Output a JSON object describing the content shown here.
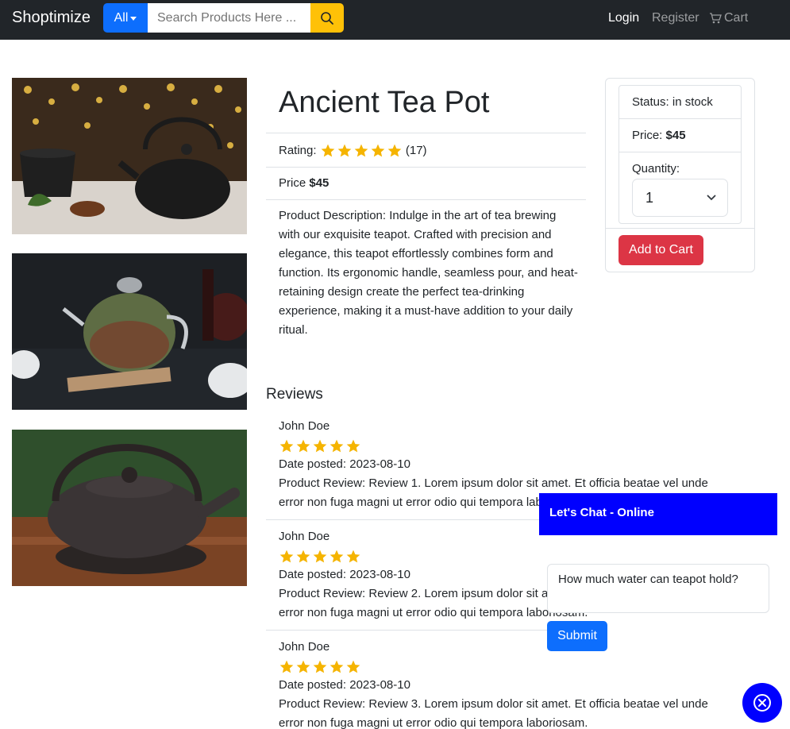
{
  "navbar": {
    "brand": "Shoptimize",
    "category_label": "All",
    "search_placeholder": "Search Products Here ...",
    "login": "Login",
    "register": "Register",
    "cart": "Cart"
  },
  "product": {
    "title": "Ancient Tea Pot",
    "rating_label": "Rating:",
    "rating_stars": 5,
    "rating_count": "(17)",
    "price_label": "Price",
    "price_value": "$45",
    "description": "Product Description: Indulge in the art of tea brewing with our exquisite teapot. Crafted with precision and elegance, this teapot effortlessly combines form and function. Its ergonomic handle, seamless pour, and heat-retaining design create the perfect tea-drinking experience, making it a must-have addition to your daily ritual."
  },
  "cart_card": {
    "status": "Status: in stock",
    "price_label": "Price:",
    "price_value": "$45",
    "quantity_label": "Quantity:",
    "quantity_value": "1",
    "add_button": "Add to Cart"
  },
  "reviews": {
    "heading": "Reviews",
    "items": [
      {
        "name": "John Doe",
        "stars": 5,
        "date": "Date posted: 2023-08-10",
        "line1": "Product Review: Review 1. Lorem ipsum dolor sit amet. Et officia beatae vel unde",
        "line2": "error non fuga magni ut error odio qui tempora laboriosam."
      },
      {
        "name": "John Doe",
        "stars": 5,
        "date": "Date posted: 2023-08-10",
        "line1": "Product Review: Review 2. Lorem ipsum dolor sit amet. Et officia beatae vel unde",
        "line2": "error non fuga magni ut error odio qui tempora laboriosam."
      },
      {
        "name": "John Doe",
        "stars": 5,
        "date": "Date posted: 2023-08-10",
        "line1": "Product Review: Review 3. Lorem ipsum dolor sit amet. Et officia beatae vel unde",
        "line2": "error non fuga magni ut error odio qui tempora laboriosam."
      }
    ]
  },
  "chat": {
    "header": "Let's Chat - Online",
    "input_value": "How much water can teapot hold?",
    "submit": "Submit"
  },
  "colors": {
    "navbar_bg": "#212529",
    "primary": "#0d6efd",
    "warning": "#ffc107",
    "danger": "#dc3545",
    "chat_blue": "#0000ff",
    "star": "#f5b400"
  },
  "icons": {
    "search": "magnifier-icon",
    "cart": "cart-icon",
    "close": "close-circle-icon"
  }
}
